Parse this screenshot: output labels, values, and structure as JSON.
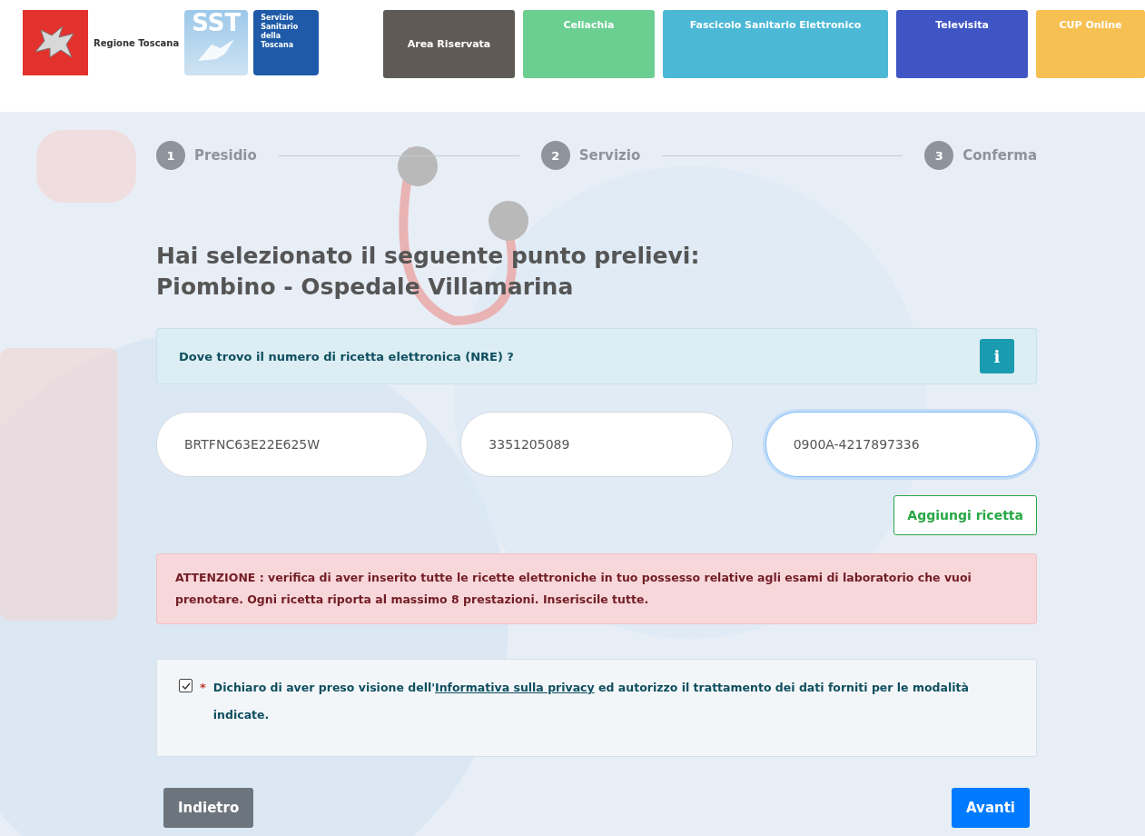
{
  "header": {
    "region_name": "Regione Toscana",
    "sst_logo": "SST",
    "sst_name": [
      "Servizio",
      "Sanitario",
      "della",
      "Toscana"
    ],
    "nav": [
      {
        "label": "Area Riservata",
        "color": "#5f5a55"
      },
      {
        "label": "Celiachia",
        "color": "#6bcf91"
      },
      {
        "label": "Fascicolo Sanitario Elettronico",
        "color": "#4bb8d6"
      },
      {
        "label": "Televisita",
        "color": "#3f55c4"
      },
      {
        "label": "CUP Online",
        "color": "#f7c052"
      }
    ]
  },
  "steps": [
    {
      "number": "1",
      "label": "Presidio"
    },
    {
      "number": "2",
      "label": "Servizio"
    },
    {
      "number": "3",
      "label": "Conferma"
    }
  ],
  "title": [
    "Hai selezionato il seguente punto prelievi:",
    "Piombino - Ospedale Villamarina"
  ],
  "info_bar": {
    "text": "Dove trovo il numero di ricetta elettronica (NRE) ?",
    "icon": "i"
  },
  "fields": [
    {
      "value": "BRTFNC63E22E625W",
      "focused": false
    },
    {
      "value": "3351205089",
      "focused": false
    },
    {
      "value": "0900A-4217897336",
      "focused": true
    }
  ],
  "add_button": "Aggiungi ricetta",
  "alert": "ATTENZIONE : verifica di aver inserito tutte le ricette elettroniche in tuo possesso relative agli esami di laboratorio che vuoi prenotare. Ogni ricetta riporta al massimo 8 prestazioni. Inseriscile tutte.",
  "consent": {
    "checked": true,
    "required_mark": "*",
    "text_before": "Dichiaro di aver preso visione dell'",
    "link": "Informativa sulla privacy",
    "text_after": " ed autorizzo il trattamento dei dati forniti per le modalità indicate."
  },
  "buttons": {
    "back": "Indietro",
    "next": "Avanti"
  }
}
